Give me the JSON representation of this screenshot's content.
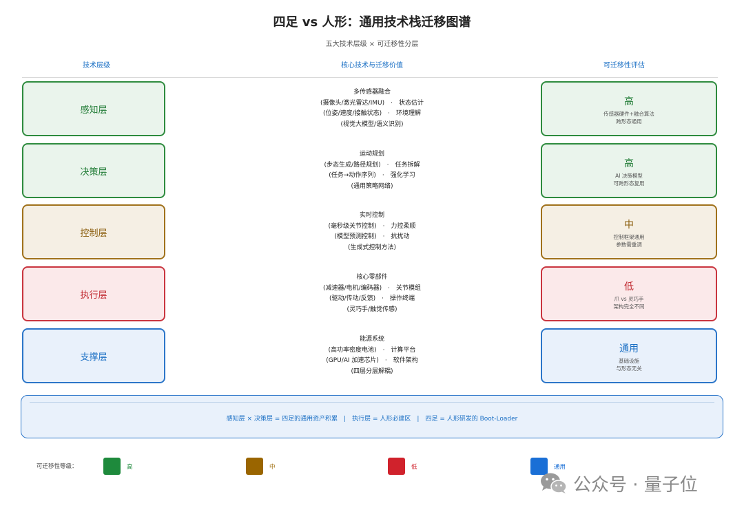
{
  "title": "四足 vs 人形：通用技术栈迁移图谱",
  "subtitle": "五大技术层级 × 可迁移性分层",
  "headers": {
    "left": "技术层级",
    "middle": "核心技术与迁移价值",
    "right": "可迁移性评估"
  },
  "layers": [
    {
      "name": "感知层",
      "lines": [
        "多传感器融合",
        "(摄像头/激光雷达/IMU)　·　状态估计",
        "(位姿/速度/接触状态)　·　环境理解",
        "(视觉大模型/语义识别)"
      ],
      "level": "高",
      "desc1": "传感器硬件+融合算法",
      "desc2": "跨形态通用",
      "color": "#2e8b3e"
    },
    {
      "name": "决策层",
      "lines": [
        "运动规划",
        "(步态生成/路径规划)　·　任务拆解",
        "(任务→动作序列)　·　强化学习",
        "(通用策略网络)"
      ],
      "level": "高",
      "desc1": "AI 决策模型",
      "desc2": "可跨形态复用",
      "color": "#2e8b3e"
    },
    {
      "name": "控制层",
      "lines": [
        "实时控制",
        "(毫秒级关节控制)　·　力控柔顺",
        "(模型预测控制)　·　抗扰动",
        "(生成式控制方法)"
      ],
      "level": "中",
      "desc1": "控制框架通用",
      "desc2": "参数需重调",
      "color": "#a0711b"
    },
    {
      "name": "执行层",
      "lines": [
        "核心零部件",
        "(减速器/电机/编码器)　·　关节模组",
        "(驱动/传动/反馈)　·　操作终端",
        "(灵巧手/触觉传感)"
      ],
      "level": "低",
      "desc1": "爪 vs 灵巧手",
      "desc2": "架构完全不同",
      "color": "#c9353f"
    },
    {
      "name": "支撑层",
      "lines": [
        "能源系统",
        "(高功率密度电池)　·　计算平台",
        "(GPU/AI 加速芯片)　·　软件架构",
        "(四层分层解耦)"
      ],
      "level": "通用",
      "desc1": "基础设施",
      "desc2": "与形态无关",
      "color": "#2c76c9"
    }
  ],
  "summary": "感知层 × 决策层 = 四足的通用资产积累　|　执行层 = 人形必建区　|　四足 = 人形研发的 Boot-Loader",
  "legend": {
    "label": "可迁移性等级：",
    "items": [
      {
        "text": "高",
        "color": "#1e8a3c"
      },
      {
        "text": "中",
        "color": "#9a6500"
      },
      {
        "text": "低",
        "color": "#d0222c"
      },
      {
        "text": "通用",
        "color": "#1a6fd6"
      }
    ]
  },
  "watermark": "公众号 · 量子位"
}
